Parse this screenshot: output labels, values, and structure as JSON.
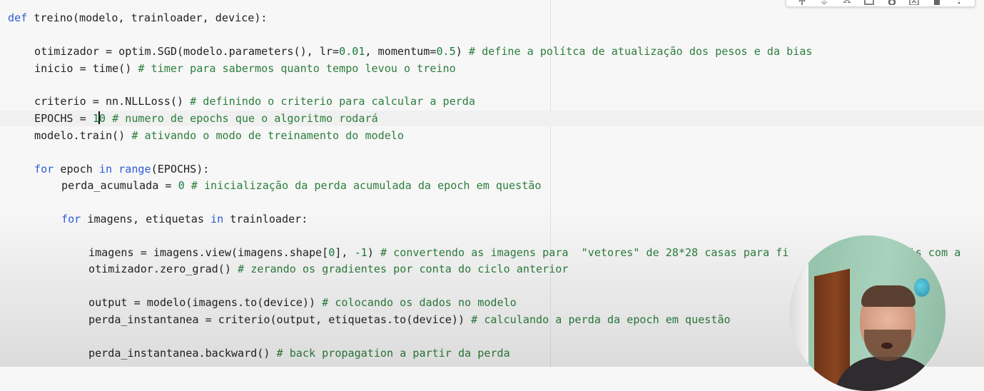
{
  "code": {
    "l1": [
      "def",
      " ",
      "treino",
      "(modelo, trainloader, device):"
    ],
    "l2": [
      "otimizador = optim.SGD(modelo.parameters(), lr=",
      "0.01",
      ", momentum=",
      "0.5",
      ") ",
      "# define a polítca de atualização dos pesos e da bias"
    ],
    "l3": [
      "inicio = time() ",
      "# timer para sabermos quanto tempo levou o treino"
    ],
    "l4": [
      "criterio = nn.NLLLoss() ",
      "# definindo o criterio para calcular a perda"
    ],
    "l5": [
      "EPOCHS = ",
      "1",
      "0",
      " ",
      "# numero de epochs que o algoritmo rodará"
    ],
    "l6": [
      "modelo.train() ",
      "# ativando o modo de treinamento do modelo"
    ],
    "l7": [
      "for",
      " epoch ",
      "in",
      " ",
      "range",
      "(EPOCHS):"
    ],
    "l8": [
      "perda_acumulada = ",
      "0",
      " ",
      "# inicialização da perda acumulada da epoch em questão"
    ],
    "l9": [
      "for",
      " imagens, etiquetas ",
      "in",
      " trainloader:"
    ],
    "l10": [
      "imagens = imagens.view(imagens.shape[",
      "0",
      "], ",
      "-1",
      ") ",
      "# convertendo as imagens para  \"vetores\" de 28*28 casas para fi",
      "veis com a"
    ],
    "l11": [
      "otimizador.zero_grad() ",
      "# zerando os gradientes por conta do ciclo anterior"
    ],
    "l12": [
      "output = modelo(imagens.to(device)) ",
      "# colocando os dados no modelo"
    ],
    "l13": [
      "perda_instantanea = criterio(output, etiquetas.to(device)) ",
      "# calculando a perda da epoch em questão"
    ],
    "l14": [
      "perda_instantanea.backward() ",
      "# back propagation a partir da perda"
    ]
  },
  "toolbar_icons": [
    "move-up-icon",
    "move-down-icon",
    "link-icon",
    "comment-icon",
    "settings-icon",
    "mirror-cell-icon",
    "delete-icon",
    "more-icon"
  ],
  "colors": {
    "keyword": "#2e5bd8",
    "number": "#1a7a3d",
    "comment": "#2b7d3b",
    "background": "#f7f7f7"
  }
}
